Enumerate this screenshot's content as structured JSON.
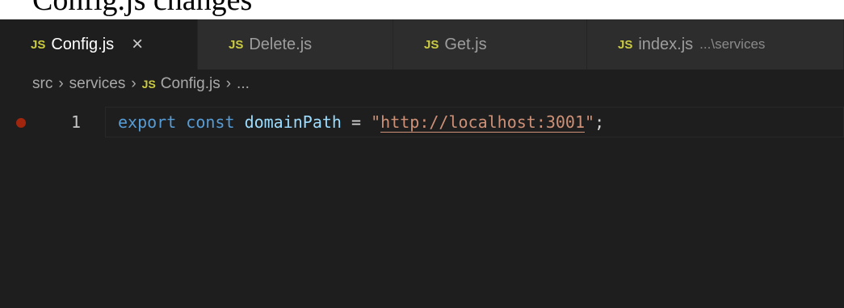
{
  "top_crop_text": "Config.js changes",
  "tabs": [
    {
      "icon": "JS",
      "label": "Config.js",
      "active": true,
      "close": "×"
    },
    {
      "icon": "JS",
      "label": "Delete.js",
      "active": false
    },
    {
      "icon": "JS",
      "label": "Get.js",
      "active": false
    },
    {
      "icon": "JS",
      "label": "index.js",
      "suffix": "...\\services",
      "active": false
    }
  ],
  "breadcrumb": {
    "items": [
      "src",
      "services"
    ],
    "file_icon": "JS",
    "file": "Config.js",
    "trailing": "...",
    "separator": "›"
  },
  "code": {
    "line_number": "1",
    "keyword_export": "export",
    "keyword_const": "const",
    "identifier": "domainPath",
    "operator": " = ",
    "quote_open": "\"",
    "url": "http://localhost:3001",
    "quote_close": "\"",
    "terminator": ";"
  },
  "colors": {
    "editor_bg": "#1e1e1e",
    "tab_inactive_bg": "#2d2d2d",
    "keyword": "#569cd6",
    "identifier": "#9cdcfe",
    "string": "#ce9178",
    "js_icon": "#cbcb41",
    "breakpoint": "#a1260d"
  }
}
